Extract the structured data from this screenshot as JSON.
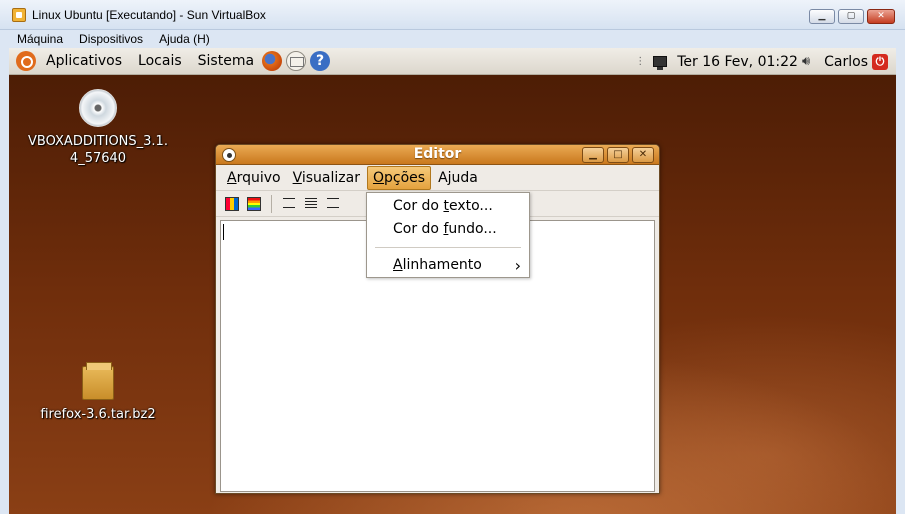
{
  "host_window": {
    "title": "Linux Ubuntu [Executando] - Sun VirtualBox",
    "menu": [
      "Máquina",
      "Dispositivos",
      "Ajuda (H)"
    ]
  },
  "panel": {
    "menus": [
      "Aplicativos",
      "Locais",
      "Sistema"
    ],
    "clock": "Ter 16 Fev, 01:22",
    "user": "Carlos"
  },
  "desktop_icons": [
    {
      "label": "VBOXADDITIONS_3.1.4_57640",
      "icon": "cd-icon"
    },
    {
      "label": "firefox-3.6.tar.bz2",
      "icon": "archive-icon"
    }
  ],
  "editor": {
    "title": "Editor",
    "menus": [
      {
        "label": "Arquivo",
        "mnemonic": "A"
      },
      {
        "label": "Visualizar",
        "mnemonic": "V"
      },
      {
        "label": "Opções",
        "mnemonic": "O"
      },
      {
        "label": "Ajuda",
        "mnemonic": "j"
      }
    ],
    "open_menu": "Opções",
    "dropdown_items": [
      {
        "pre": "Cor do ",
        "u": "t",
        "post": "exto..."
      },
      {
        "pre": "Cor do ",
        "u": "f",
        "post": "undo..."
      },
      {
        "pre": "",
        "u": "A",
        "post": "linhamento"
      }
    ],
    "text": ""
  },
  "colors": {
    "accent": "#e4a23e",
    "desktop": "#702e0c",
    "titlebar": "#c9781d"
  }
}
